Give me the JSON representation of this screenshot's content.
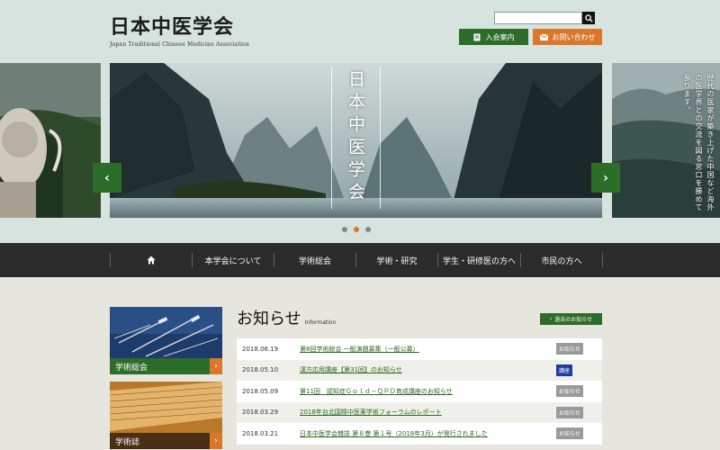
{
  "header": {
    "logo_title": "日本中医学会",
    "logo_subtitle": "Japan Traditional Chinese Medicine Association",
    "member_button": "入会案内",
    "contact_button": "お問い合わせ"
  },
  "slider": {
    "main_title": "日本中医学会",
    "right_text": "歴代の医家が築き上げた中国など海外の医学界との交流を図る窓口を勝めて参ります。",
    "prev": "‹",
    "next": "›"
  },
  "nav": {
    "items": [
      "本学会について",
      "学術総会",
      "学術・研究",
      "学生・研修医の方へ",
      "市民の方へ"
    ]
  },
  "side_cards": [
    {
      "label": "学術総会"
    },
    {
      "label": "学術誌"
    }
  ],
  "news": {
    "title": "お知らせ",
    "subtitle": "Information",
    "past_button": "過去のお知らせ",
    "items": [
      {
        "date": "2018.06.19",
        "text": "第8回学術総会 一般演題募集（一般公募）",
        "badge": "お知らせ"
      },
      {
        "date": "2018.05.10",
        "text": "漢方応用講座【第31回】のお知らせ",
        "badge": "講座"
      },
      {
        "date": "2018.05.09",
        "text": "第11回　認知症Ｇｏｌｄ－ＱＰＤ育成講座のお知らせ",
        "badge": "お知らせ"
      },
      {
        "date": "2018.03.29",
        "text": "2018年台北国際中医薬学術フォーラムのレポート",
        "badge": "お知らせ"
      },
      {
        "date": "2018.03.21",
        "text": "日本中医学会雑誌 第８巻 第１号（2018年3月）が発行されました",
        "badge": "お知らせ"
      }
    ]
  }
}
